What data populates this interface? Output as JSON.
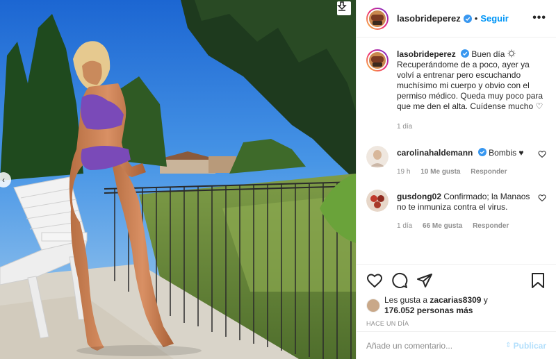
{
  "post": {
    "username": "lasobrideperez",
    "follow_label": "Seguir",
    "separator": "•",
    "more_label": "•••",
    "caption_greeting": "Buen día",
    "caption_text": "Recuperándome de a poco, ayer ya volví a entrenar pero escuchando muchísimo mi cuerpo y obvio con el permiso médico. Queda muy poco para que me den el alta. Cuídense mucho ♡",
    "caption_time": "1 día"
  },
  "comments": [
    {
      "username": "carolinahaldemann",
      "text": "Bombis ♥",
      "time": "19 h",
      "likes": "10 Me gusta",
      "reply": "Responder"
    },
    {
      "username": "gusdong02",
      "text": "Confirmado; la Manaos no te inmuniza contra el virus.",
      "time": "1 día",
      "likes": "66 Me gusta",
      "reply": "Responder"
    }
  ],
  "likes": {
    "prefix": "Les gusta a",
    "user": "zacarias8309",
    "joiner": "y",
    "count": "176.052 personas más"
  },
  "post_date": "HACE UN DÍA",
  "comment_box": {
    "placeholder": "Añade un comentario...",
    "publish_label": "Publicar"
  },
  "icons": {
    "download": "download-arrow-icon",
    "prev": "chevron-left-icon",
    "verified": "verified-badge-icon",
    "like": "heart-icon",
    "comment": "comment-bubble-icon",
    "share": "paper-plane-icon",
    "save": "bookmark-icon",
    "options": "more-options-icon"
  },
  "colors": {
    "accent": "#0095f6",
    "text": "#262626",
    "muted": "#8e8e8e",
    "publish_disabled": "#b2dffc"
  }
}
